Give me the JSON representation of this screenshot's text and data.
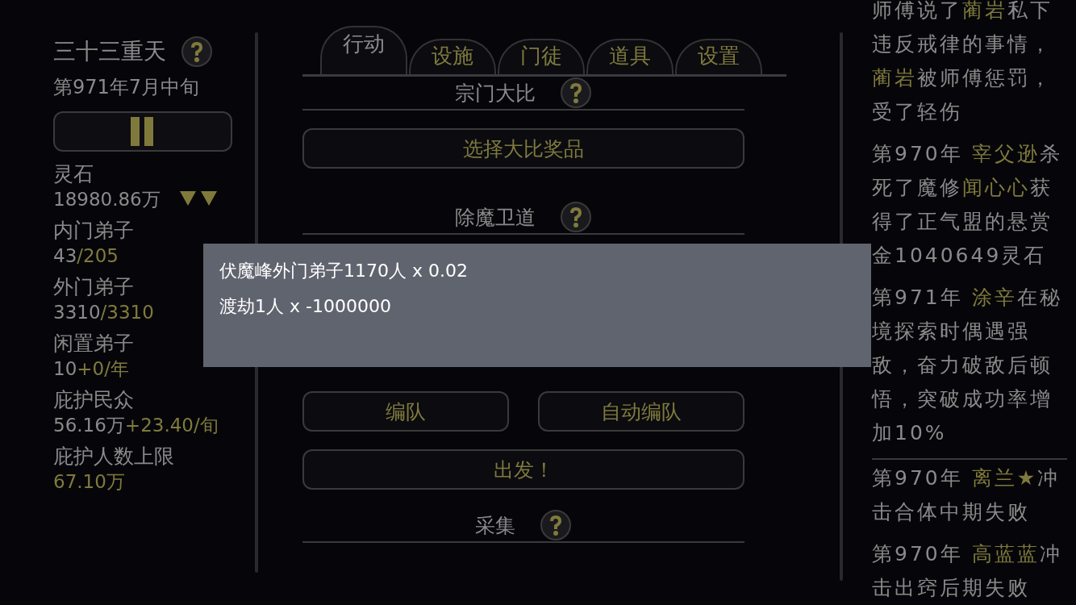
{
  "sidebar": {
    "title": "三十三重天",
    "date": "第971年7月中旬",
    "stats": [
      {
        "label": "灵石",
        "value": "18980.86万",
        "falling": true
      },
      {
        "label": "内门弟子",
        "value": "43",
        "extra": "/205"
      },
      {
        "label": "外门弟子",
        "value": "3310",
        "extra": "/3310"
      },
      {
        "label": "闲置弟子",
        "value": "10",
        "extra": "+0/年"
      },
      {
        "label": "庇护民众",
        "value": "56.16万",
        "extra": "+23.40/旬"
      },
      {
        "label": "庇护人数上限",
        "extra": "67.10万"
      }
    ]
  },
  "tabs": [
    {
      "label": "行动",
      "selected": true
    },
    {
      "label": "设施",
      "selected": false
    },
    {
      "label": "门徒",
      "selected": false
    },
    {
      "label": "道具",
      "selected": false
    },
    {
      "label": "设置",
      "selected": false
    }
  ],
  "sections": [
    {
      "title": "宗门大比",
      "buttons": [
        [
          "选择大比奖品"
        ]
      ]
    },
    {
      "title": "除魔卫道",
      "buttons": [
        [
          "编队",
          "自动编队"
        ],
        [
          "出发！"
        ]
      ]
    },
    {
      "title": "采集"
    }
  ],
  "log": [
    {
      "divider": false,
      "parts": [
        {
          "text": "师傅说了",
          "name": false
        },
        {
          "text": "蔺岩",
          "name": true
        },
        {
          "text": "私下违反戒律的事情，",
          "name": false
        },
        {
          "text": "蔺岩",
          "name": true
        },
        {
          "text": "被师傅惩罚，受了轻伤",
          "name": false
        }
      ]
    },
    {
      "divider": false,
      "parts": [
        {
          "text": "第970年 ",
          "name": false
        },
        {
          "text": "宰父逊",
          "name": true
        },
        {
          "text": "杀死了魔修",
          "name": false
        },
        {
          "text": "闻心心",
          "name": true
        },
        {
          "text": "获得了正气盟的悬赏金1040649灵石",
          "name": false
        }
      ]
    },
    {
      "divider": false,
      "parts": [
        {
          "text": "第971年 ",
          "name": false
        },
        {
          "text": "涂辛",
          "name": true
        },
        {
          "text": "在秘境探索时偶遇强敌，奋力破敌后顿悟，突破成功率增加10%",
          "name": false
        }
      ]
    },
    {
      "divider": true,
      "parts": [
        {
          "text": "第970年 ",
          "name": false
        },
        {
          "text": "离兰★",
          "name": true
        },
        {
          "text": "冲击合体中期失败",
          "name": false
        }
      ]
    },
    {
      "divider": false,
      "parts": [
        {
          "text": "第970年 ",
          "name": false
        },
        {
          "text": "高蓝蓝",
          "name": true
        },
        {
          "text": "冲击出窍后期失败",
          "name": false
        }
      ]
    }
  ],
  "popup": {
    "lines": [
      "伏魔峰外门弟子1170人 x 0.02",
      "渡劫1人 x -1000000"
    ]
  }
}
